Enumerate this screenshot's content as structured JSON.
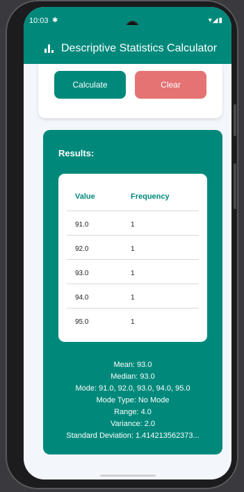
{
  "status_bar": {
    "time": "10:03",
    "settings_icon": "gear-icon",
    "icons": "wifi-icon signal-icon battery-icon"
  },
  "app_bar": {
    "icon": "bar-chart-icon",
    "title": "Descriptive Statistics Calculator"
  },
  "actions": {
    "calculate_label": "Calculate",
    "clear_label": "Clear"
  },
  "results": {
    "title": "Results:",
    "table": {
      "headers": [
        "Value",
        "Frequency"
      ],
      "rows": [
        {
          "value": "91.0",
          "frequency": "1"
        },
        {
          "value": "92.0",
          "frequency": "1"
        },
        {
          "value": "93.0",
          "frequency": "1"
        },
        {
          "value": "94.0",
          "frequency": "1"
        },
        {
          "value": "95.0",
          "frequency": "1"
        }
      ]
    },
    "stats": {
      "mean": "Mean: 93.0",
      "median": "Median: 93.0",
      "mode": "Mode: 91.0, 92.0, 93.0, 94.0, 95.0",
      "mode_type": "Mode Type: No Mode",
      "range": "Range: 4.0",
      "variance": "Variance: 2.0",
      "std_dev": "Standard Deviation: 1.414213562373..."
    }
  },
  "colors": {
    "primary": "#00897b",
    "clear": "#e57373",
    "background": "#f3f6fb"
  }
}
